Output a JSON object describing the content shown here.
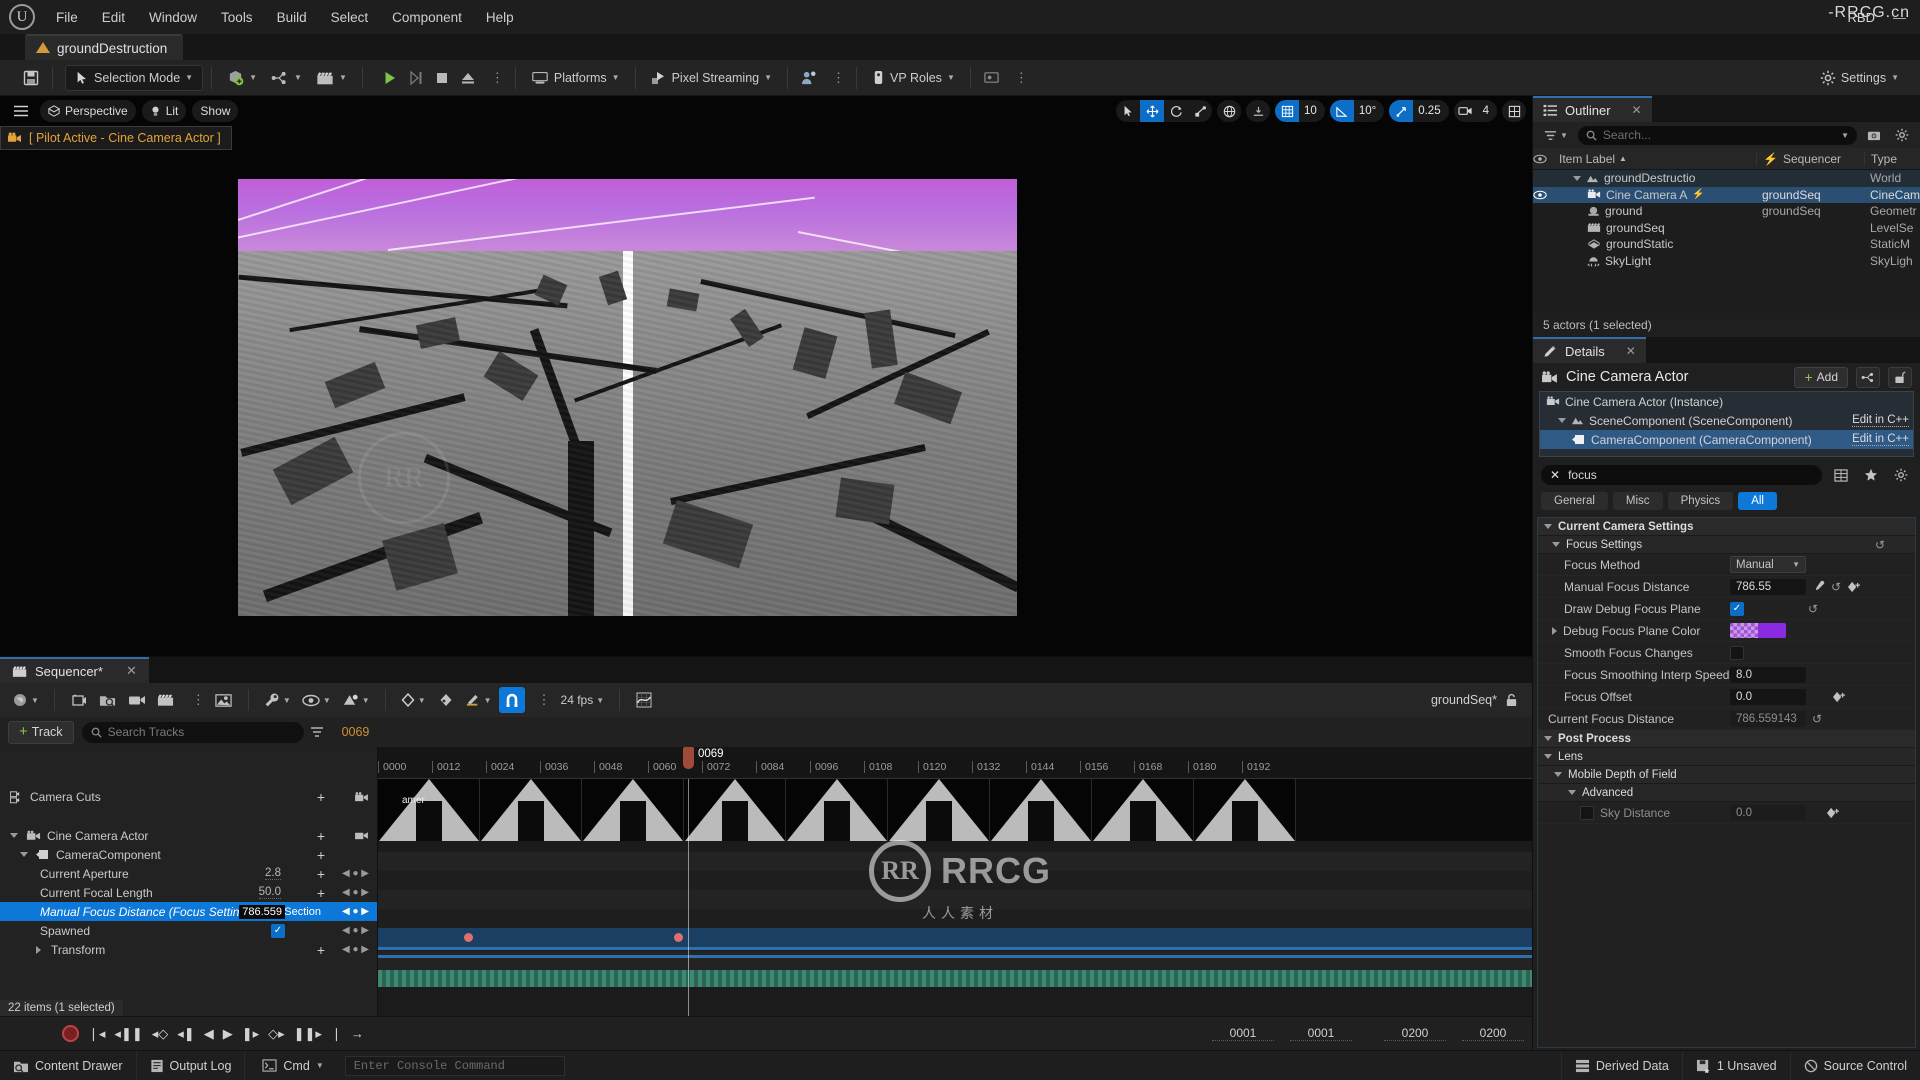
{
  "menubar": {
    "items": [
      "File",
      "Edit",
      "Window",
      "Tools",
      "Build",
      "Select",
      "Component",
      "Help"
    ],
    "right_label": "RBD",
    "watermark": "-RRCG.cn"
  },
  "project_tab": {
    "label": "groundDestruction",
    "icon": "mountain-icon"
  },
  "toolbar": {
    "save_icon": "save-icon",
    "mode_label": "Selection Mode",
    "add_icon": "add-actor-icon",
    "blueprint_icon": "blueprints-icon",
    "cinematics_icon": "cinematics-icon",
    "play_icon": "play-icon",
    "skip_icon": "play-step-icon",
    "stop_icon": "stop-icon",
    "eject_icon": "eject-icon",
    "platforms_label": "Platforms",
    "pixel_streaming_label": "Pixel Streaming",
    "vp_roles_label": "VP Roles",
    "settings_label": "Settings"
  },
  "viewport": {
    "perspective_label": "Perspective",
    "lit_label": "Lit",
    "show_label": "Show",
    "pilot_banner": "[ Pilot Active - Cine Camera Actor ]",
    "grid_snap_value": "10",
    "rotation_snap_value": "10°",
    "scale_snap_value": "0.25",
    "camera_speed_value": "4"
  },
  "outliner": {
    "tab_label": "Outliner",
    "search_placeholder": "Search...",
    "columns": {
      "item_label": "Item Label",
      "sequencer": "Sequencer",
      "type": "Type"
    },
    "rows": [
      {
        "label": "groundDestructio",
        "icon": "world-icon",
        "sequencer": "",
        "type": "World",
        "depth": 0,
        "selected": false,
        "eye": false,
        "world": true
      },
      {
        "label": "Cine Camera A",
        "icon": "cine-camera-icon",
        "sequencer": "groundSeq",
        "type": "CineCam",
        "depth": 1,
        "selected": true,
        "eye": true,
        "world": false
      },
      {
        "label": "ground",
        "icon": "geometry-icon",
        "sequencer": "groundSeq",
        "type": "Geometr",
        "depth": 1,
        "selected": false,
        "eye": false,
        "world": false
      },
      {
        "label": "groundSeq",
        "icon": "level-sequence-icon",
        "sequencer": "",
        "type": "LevelSe",
        "depth": 1,
        "selected": false,
        "eye": false,
        "world": false
      },
      {
        "label": "groundStatic",
        "icon": "static-mesh-icon",
        "sequencer": "",
        "type": "StaticM",
        "depth": 1,
        "selected": false,
        "eye": false,
        "world": false
      },
      {
        "label": "SkyLight",
        "icon": "sky-light-icon",
        "sequencer": "",
        "type": "SkyLigh",
        "depth": 1,
        "selected": false,
        "eye": false,
        "world": false
      }
    ],
    "footer": "5 actors (1 selected)"
  },
  "details": {
    "tab_label": "Details",
    "actor_title": "Cine Camera Actor",
    "add_label": "Add",
    "components": [
      {
        "label": "Cine Camera Actor  (Instance)",
        "cpp": "",
        "selected": false,
        "depth": 0
      },
      {
        "label": "SceneComponent (SceneComponent)",
        "cpp": "Edit in C++",
        "selected": false,
        "depth": 1
      },
      {
        "label": "CameraComponent (CameraComponent)",
        "cpp": "Edit in C++",
        "selected": true,
        "depth": 2
      }
    ],
    "search_value": "focus",
    "filters": [
      "General",
      "Misc",
      "Physics",
      "All"
    ],
    "active_filter": "All",
    "sections": [
      {
        "kind": "cat",
        "label": "Current Camera Settings",
        "depth": 0
      },
      {
        "kind": "cat",
        "label": "Focus Settings",
        "depth": 1,
        "has_reset": true
      },
      {
        "kind": "prop",
        "label": "Focus Method",
        "value": "Manual",
        "control": "dropdown"
      },
      {
        "kind": "prop",
        "label": "Manual Focus Distance",
        "value": "786.55",
        "control": "field",
        "has_eyedropper": true,
        "has_reset": true,
        "has_key": true
      },
      {
        "kind": "prop",
        "label": "Draw Debug Focus Plane",
        "value": "",
        "control": "checkbox_on",
        "has_reset": true
      },
      {
        "kind": "prop",
        "label": "Debug Focus Plane Color",
        "value": "",
        "control": "color"
      },
      {
        "kind": "prop",
        "label": "Smooth Focus Changes",
        "value": "",
        "control": "checkbox_off"
      },
      {
        "kind": "prop",
        "label": "Focus Smoothing Interp Speed",
        "value": "8.0",
        "control": "field"
      },
      {
        "kind": "prop",
        "label": "Focus Offset",
        "value": "0.0",
        "control": "field",
        "has_key": true
      },
      {
        "kind": "prop",
        "label": "Current Focus Distance",
        "value": "786.559143",
        "control": "field_ro",
        "has_reset": true,
        "indent": 0
      },
      {
        "kind": "cat",
        "label": "Post Process",
        "depth": 0
      },
      {
        "kind": "cat",
        "label": "Lens",
        "depth": 0
      },
      {
        "kind": "cat",
        "label": "Mobile Depth of Field",
        "depth": 1
      },
      {
        "kind": "cat",
        "label": "Advanced",
        "depth": 2
      },
      {
        "kind": "prop",
        "label": "Sky Distance",
        "value": "0.0",
        "control": "field_ro",
        "has_checkbox": true,
        "has_key": true,
        "indent": 3
      }
    ]
  },
  "sequencer": {
    "tab_label": "Sequencer*",
    "add_track_label": "Track",
    "search_placeholder": "Search Tracks",
    "current_frame": "0069",
    "fps_label": "24 fps",
    "sequence_name": "groundSeq*",
    "tracks": [
      {
        "label": "Camera Cuts",
        "icon": "camera-cuts-icon",
        "depth": 0,
        "value": "",
        "selected": false,
        "has_add": true
      },
      {
        "label": "Cine Camera Actor",
        "icon": "cine-camera-icon",
        "depth": 0,
        "value": "",
        "selected": false,
        "has_add": true
      },
      {
        "label": "CameraComponent",
        "icon": "camera-component-icon",
        "depth": 1,
        "value": "",
        "selected": false,
        "has_add": true
      },
      {
        "label": "Current Aperture",
        "icon": "",
        "depth": 2,
        "value": "2.8",
        "selected": false,
        "has_add": true
      },
      {
        "label": "Current Focal Length",
        "icon": "",
        "depth": 2,
        "value": "50.0",
        "selected": false,
        "has_add": true
      },
      {
        "label": "Manual Focus Distance (Focus Settings)",
        "icon": "",
        "depth": 2,
        "value": "786.559",
        "selected": true,
        "has_add": false,
        "tooltip": "Section"
      },
      {
        "label": "Spawned",
        "icon": "",
        "depth": 2,
        "value": "",
        "selected": false,
        "control": "checkbox_on"
      },
      {
        "label": "Transform",
        "icon": "",
        "depth": 2,
        "value": "",
        "selected": false,
        "has_add": true
      }
    ],
    "status": "22 items (1 selected)",
    "ruler_ticks": [
      "0000",
      "0012",
      "0024",
      "0036",
      "0048",
      "0060",
      "0072",
      "0084",
      "0096",
      "0108",
      "0120",
      "0132",
      "0144",
      "0156",
      "0168",
      "0180",
      "0192"
    ],
    "playhead_label": "0069",
    "transport": {
      "record_icon": "record-icon",
      "buttons": [
        "jump-to-start",
        "previous-frame",
        "previous-key",
        "step-back",
        "play-reverse",
        "play-forward",
        "step-forward",
        "next-key",
        "next-frame",
        "jump-to-end",
        "loop"
      ],
      "range_start": "0001",
      "view_start": "0001",
      "view_end": "0200",
      "range_end": "0200"
    }
  },
  "statusbar": {
    "content_drawer": "Content Drawer",
    "output_log": "Output Log",
    "cmd_label": "Cmd",
    "console_placeholder": "Enter Console Command",
    "derived_data": "Derived Data",
    "unsaved": "1 Unsaved",
    "source_control": "Source Control"
  },
  "watermark": {
    "brand": "RRCG",
    "sub": "人人素材",
    "ring": "RR"
  },
  "colors": {
    "accent_blue": "#0d78d7",
    "selection_blue": "#2a4f73",
    "orange": "#cf9233",
    "green": "#8dc24a",
    "purple": "#8a2be2"
  }
}
